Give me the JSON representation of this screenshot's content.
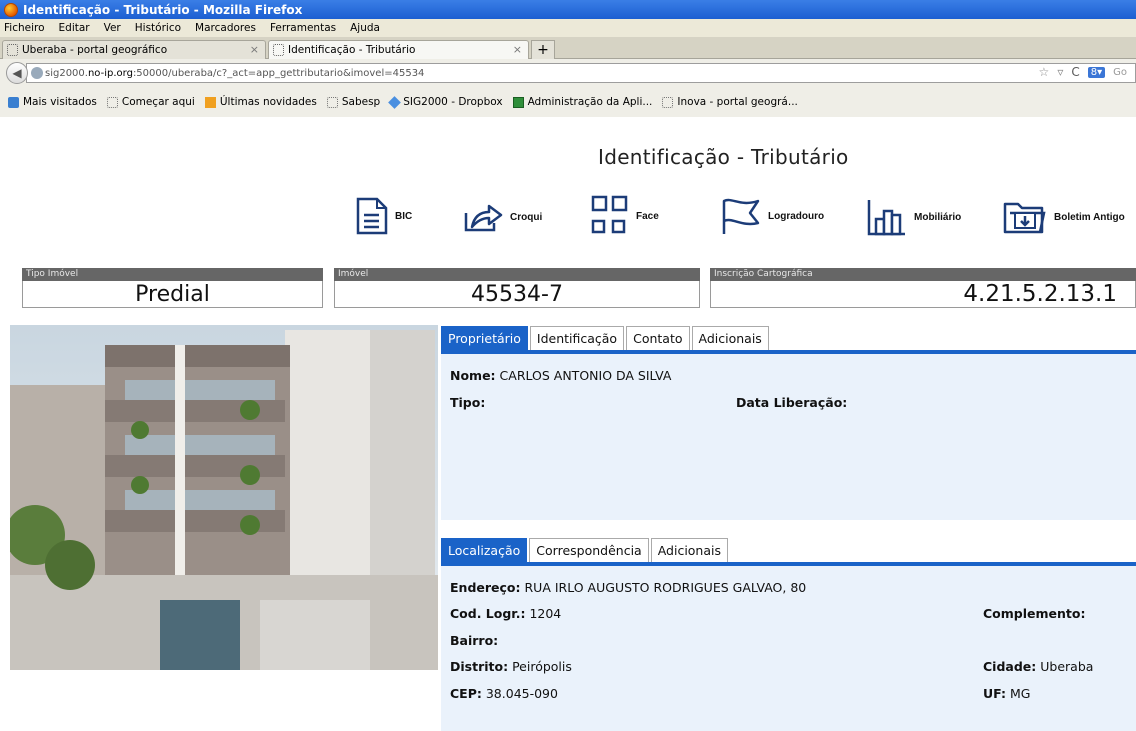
{
  "window": {
    "title": "Identificação - Tributário - Mozilla Firefox"
  },
  "menu": [
    "Ficheiro",
    "Editar",
    "Ver",
    "Histórico",
    "Marcadores",
    "Ferramentas",
    "Ajuda"
  ],
  "browser_tabs": [
    {
      "label": "Uberaba - portal geográfico",
      "active": false
    },
    {
      "label": "Identificação - Tributário",
      "active": true
    }
  ],
  "url": {
    "prefix": "sig2000.",
    "host": "no-ip.org",
    "rest": ":50000/uberaba/c?_act=app_gettributario&imovel=45534",
    "search_placeholder": "Go"
  },
  "bookmarks": [
    {
      "label": "Mais visitados",
      "icon": "search-icon"
    },
    {
      "label": "Começar aqui",
      "icon": "page-icon"
    },
    {
      "label": "Últimas novidades",
      "icon": "rss-icon"
    },
    {
      "label": "Sabesp",
      "icon": "page-icon"
    },
    {
      "label": "SIG2000 - Dropbox",
      "icon": "dropbox-icon"
    },
    {
      "label": "Administração da Apli...",
      "icon": "app-icon"
    },
    {
      "label": "Inova - portal geográ...",
      "icon": "page-icon"
    }
  ],
  "page": {
    "title": "Identificação - Tributário"
  },
  "toolbar": {
    "bic": "BIC",
    "croqui": "Croqui",
    "face": "Face",
    "logradouro": "Logradouro",
    "mobiliario": "Mobiliário",
    "boletim": "Boletim Antigo"
  },
  "fields": {
    "tipo_imovel": {
      "label": "Tipo Imóvel",
      "value": "Predial"
    },
    "imovel": {
      "label": "Imóvel",
      "value": "45534-7"
    },
    "inscricao": {
      "label": "Inscrição Cartográfica",
      "value": "4.21.5.2.13.1"
    }
  },
  "owner_tabs": [
    "Proprietário",
    "Identificação",
    "Contato",
    "Adicionais"
  ],
  "owner": {
    "nome_label": "Nome:",
    "nome": "CARLOS ANTONIO DA SILVA",
    "tipo_label": "Tipo:",
    "data_label": "Data Liberação:"
  },
  "location_tabs": [
    "Localização",
    "Correspondência",
    "Adicionais"
  ],
  "location": {
    "endereco_label": "Endereço:",
    "endereco": "RUA IRLO AUGUSTO RODRIGUES GALVAO, 80",
    "cod_label": "Cod. Logr.:",
    "cod": "1204",
    "complemento_label": "Complemento:",
    "bairro_label": "Bairro:",
    "distrito_label": "Distrito:",
    "distrito": "Peirópolis",
    "cidade_label": "Cidade:",
    "cidade": "Uberaba",
    "cep_label": "CEP:",
    "cep": "38.045-090",
    "uf_label": "UF:",
    "uf": "MG"
  }
}
